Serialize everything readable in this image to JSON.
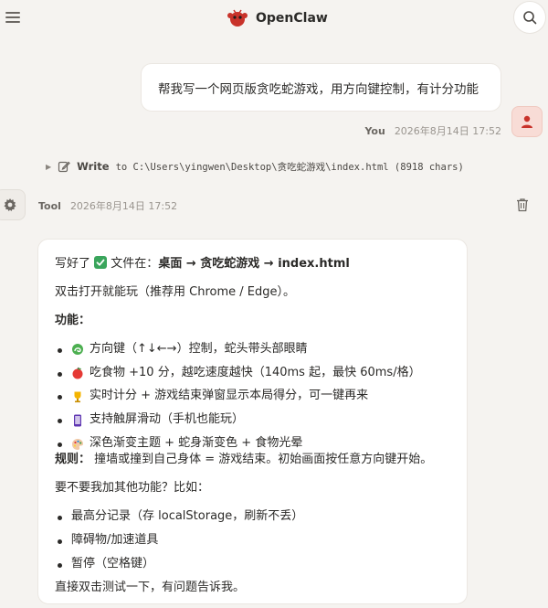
{
  "header": {
    "title": "OpenClaw",
    "icons": {
      "menu": "hamburger-menu-icon",
      "logo": "lobster-claw-logo-icon",
      "search": "search-icon"
    }
  },
  "colors": {
    "background": "#f5f3f0",
    "card": "#ffffff",
    "accent": "#c8322a",
    "user_avatar_bg": "#f8dcd6"
  },
  "user_message": {
    "text": "帮我写一个网页版贪吃蛇游戏，用方向键控制，有计分功能",
    "sender": "You",
    "timestamp": "2026年8月14日 17:52"
  },
  "tool_call": {
    "tool": "Write",
    "args": "to C:\\Users\\yingwen\\Desktop\\贪吃蛇游戏\\index.html (8918 chars)"
  },
  "tool_message": {
    "sender": "Tool",
    "timestamp": "2026年8月14日 17:52"
  },
  "reply": {
    "line1_pre": "写好了",
    "line1_mid": " 文件在：",
    "line1_path": "桌面 → 贪吃蛇游戏 → index.html",
    "line2": "双击打开就能玩（推荐用 Chrome / Edge）。",
    "features_heading": "功能：",
    "features": [
      {
        "icon": "snake-icon",
        "text": "方向键（↑↓←→）控制，蛇头带头部眼睛"
      },
      {
        "icon": "apple-icon",
        "text": "吃食物 +10 分，越吃速度越快（140ms 起，最快 60ms/格）"
      },
      {
        "icon": "trophy-icon",
        "text": "实时计分 + 游戏结束弹窗显示本局得分，可一键再来"
      },
      {
        "icon": "phone-icon",
        "text": "支持触屏滑动（手机也能玩）"
      },
      {
        "icon": "palette-icon",
        "text": "深色渐变主题 + 蛇身渐变色 + 食物光晕"
      }
    ],
    "rules_label": "规则：",
    "rules_text": " 撞墙或撞到自己身体 = 游戏结束。初始画面按任意方向键开始。",
    "ask": "要不要我加其他功能？比如：",
    "suggestions": [
      "最高分记录（存 localStorage，刷新不丢）",
      "障碍物/加速道具",
      "暂停（空格键）"
    ],
    "closing": "直接双击测试一下，有问题告诉我。"
  }
}
